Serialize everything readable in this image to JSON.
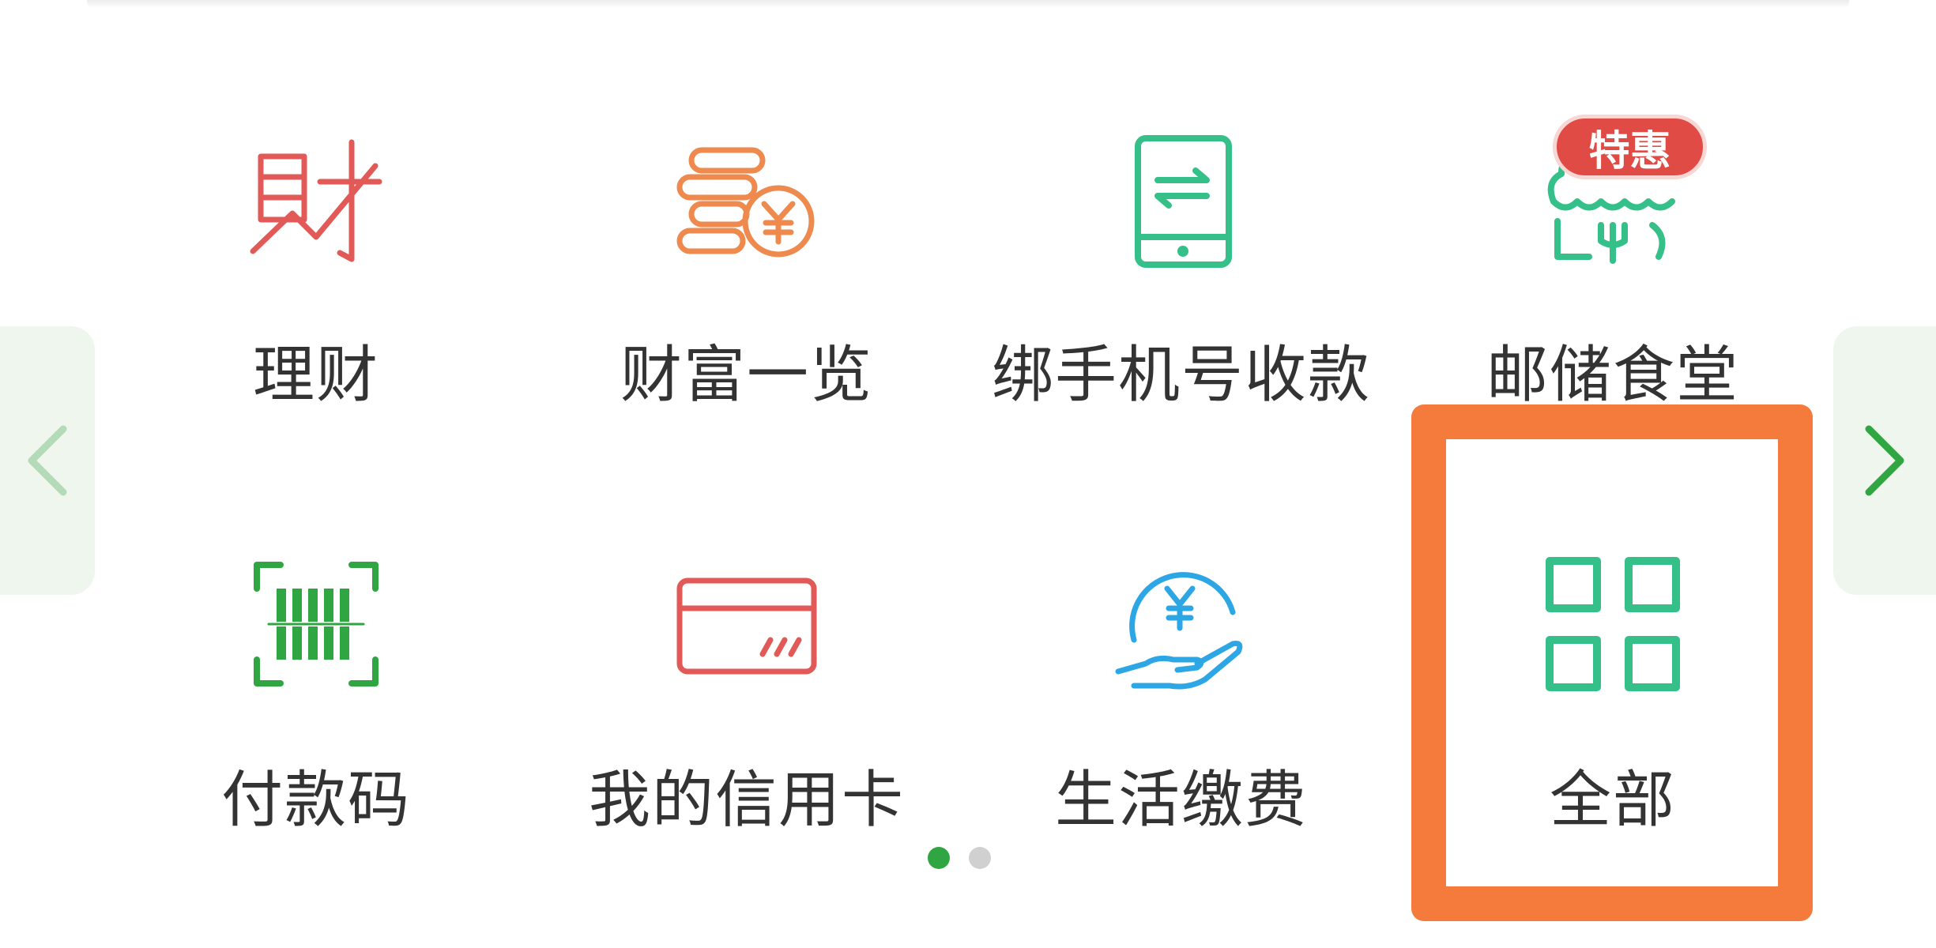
{
  "shortcuts_row1": [
    {
      "label": "理财",
      "icon": "finance-icon",
      "color": "#e25a57"
    },
    {
      "label": "财富一览",
      "icon": "coins-yen-icon",
      "color": "#ee8a4d"
    },
    {
      "label": "绑手机号收款",
      "icon": "phone-transfer-icon",
      "color": "#35c08a"
    },
    {
      "label": "邮储食堂",
      "icon": "canteen-icon",
      "color": "#35c08a",
      "badge": "特惠"
    }
  ],
  "shortcuts_row2": [
    {
      "label": "付款码",
      "icon": "barcode-scan-icon",
      "color": "#2fa642"
    },
    {
      "label": "我的信用卡",
      "icon": "credit-card-icon",
      "color": "#e25a57"
    },
    {
      "label": "生活缴费",
      "icon": "hand-yen-icon",
      "color": "#2da6e6"
    },
    {
      "label": "全部",
      "icon": "grid-all-icon",
      "color": "#35c08a"
    }
  ],
  "pagination": {
    "total": 2,
    "active": 1
  },
  "colors": {
    "highlight": "#f47b3b",
    "badge": "#e04b45",
    "arrow_green": "#2fa642"
  }
}
